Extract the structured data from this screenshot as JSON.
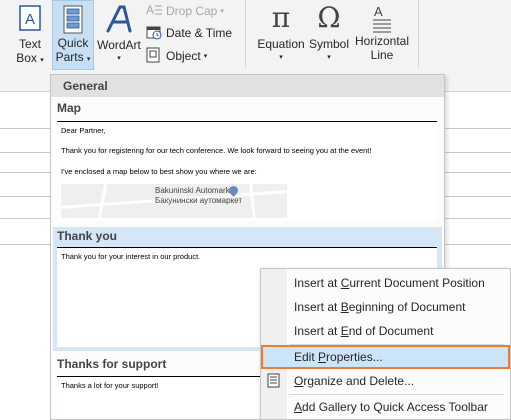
{
  "ribbon": {
    "text_box": {
      "line1": "Text",
      "line2": "Box",
      "icon": "text-box-icon"
    },
    "quick_parts": {
      "line1": "Quick",
      "line2": "Parts",
      "icon": "quick-parts-icon"
    },
    "wordart": {
      "label": "WordArt",
      "icon": "wordart-icon"
    },
    "drop_cap": {
      "label": "Drop Cap",
      "icon": "drop-cap-icon"
    },
    "date_time": {
      "label": "Date & Time",
      "icon": "calendar-icon"
    },
    "object": {
      "label": "Object",
      "icon": "object-icon"
    },
    "equation": {
      "label": "Equation",
      "symbol": "π",
      "icon": "pi-icon"
    },
    "symbol": {
      "label": "Symbol",
      "symbol": "Ω",
      "icon": "omega-icon"
    },
    "horizontal_line": {
      "line1": "Horizontal",
      "line2": "Line",
      "icon": "horizontal-line-icon"
    }
  },
  "gallery": {
    "header": "General",
    "entries": [
      {
        "title": "Map",
        "lines": [
          "Dear Partner,",
          "Thank you for registering for our tech conference. We look forward to seeing you at the event!",
          "I've enclosed a map below to best show you where we are:"
        ],
        "map_label1": "Bakuninski Automarket",
        "map_label2": "Бакунински аутомаркет"
      },
      {
        "title": "Thank you",
        "lines": [
          "Thank you for your interest in our product."
        ]
      },
      {
        "title": "Thanks for support",
        "lines": [
          "Thanks a lot for your support!"
        ]
      }
    ]
  },
  "context_menu": {
    "items": [
      {
        "pre": "Insert at ",
        "key": "C",
        "post": "urrent Document Position"
      },
      {
        "pre": "Insert at ",
        "key": "B",
        "post": "eginning of Document"
      },
      {
        "pre": "Insert at ",
        "key": "E",
        "post": "nd of Document"
      },
      {
        "pre": "Edit ",
        "key": "P",
        "post": "roperties..."
      },
      {
        "pre": "",
        "key": "O",
        "post": "rganize and Delete..."
      },
      {
        "pre": "",
        "key": "A",
        "post": "dd Gallery to Quick Access Toolbar"
      }
    ]
  }
}
